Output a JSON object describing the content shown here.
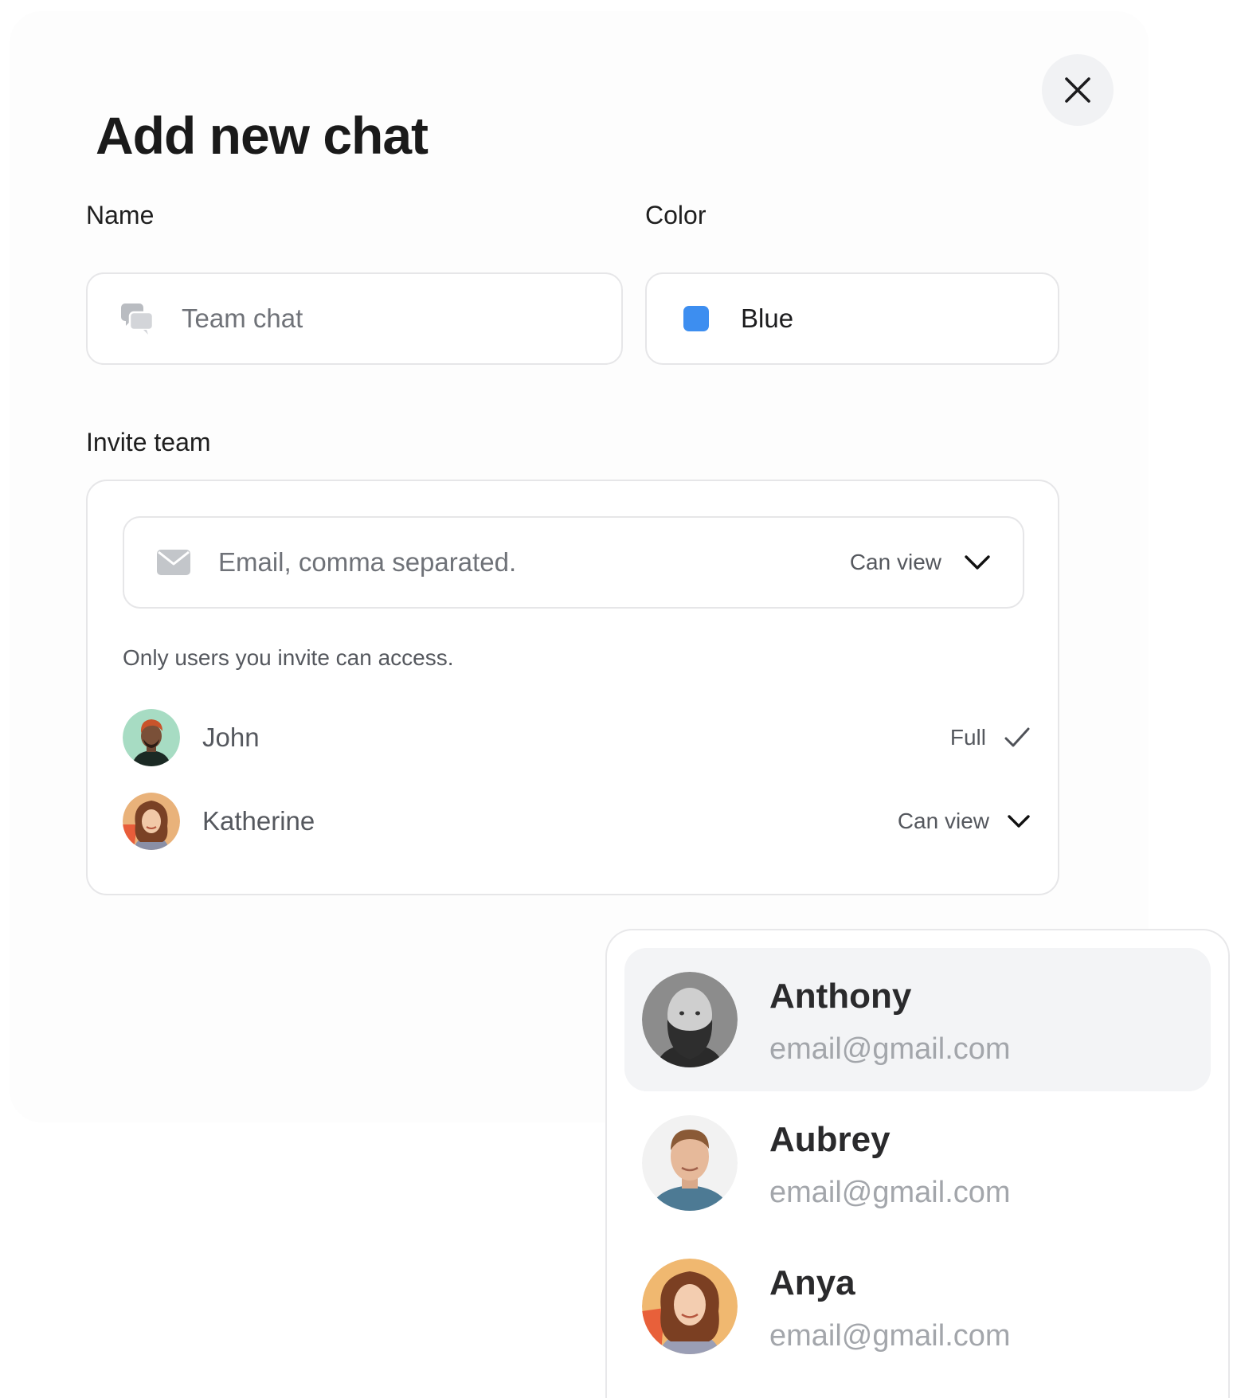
{
  "modal": {
    "title": "Add new chat",
    "close_icon": "close-icon"
  },
  "name_field": {
    "label": "Name",
    "icon": "chat-bubbles-icon",
    "value": "Team chat"
  },
  "color_field": {
    "label": "Color",
    "value": "Blue",
    "swatch_color": "#3d8ef0"
  },
  "invite": {
    "label": "Invite team",
    "email_icon": "mail-icon",
    "email_placeholder": "Email, comma separated.",
    "permission": "Can view",
    "note": "Only users you invite can access.",
    "members": [
      {
        "name": "John",
        "permission": "Full",
        "permission_icon": "check-icon"
      },
      {
        "name": "Katherine",
        "permission": "Can view",
        "permission_icon": "chevron-down-icon"
      }
    ]
  },
  "suggestions": [
    {
      "name": "Anthony",
      "email": "email@gmail.com",
      "highlighted": true
    },
    {
      "name": "Aubrey",
      "email": "email@gmail.com",
      "highlighted": false
    },
    {
      "name": "Anya",
      "email": "email@gmail.com",
      "highlighted": false
    }
  ]
}
